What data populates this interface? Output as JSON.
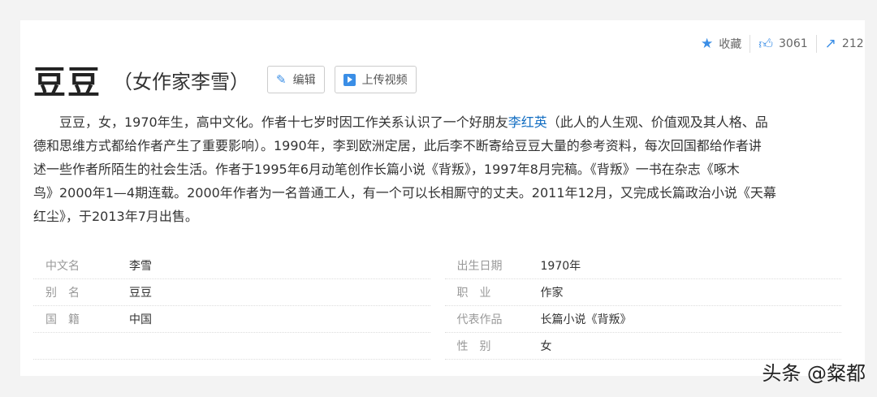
{
  "toolbar": {
    "favorite_label": "收藏",
    "like_count": "3061",
    "share_count": "212"
  },
  "header": {
    "title": "豆豆",
    "subtitle": "（女作家李雪）",
    "edit_label": "编辑",
    "upload_video_label": "上传视频"
  },
  "summary": {
    "lines": [
      [
        "　　豆豆，女，1970年生，高中文化。作者十七岁时因工作关系认识了一个好朋友",
        "李红英",
        "（此人的人生观、价值观及其人格、品"
      ],
      "德和思维方式都给作者产生了重要影响）。1990年，李到欧洲定居，此后李不断寄给豆豆大量的参考资料，每次回国都给作者讲",
      "述一些作者所陌生的社会生活。作者于1995年6月动笔创作长篇小说《背叛》，1997年8月完稿。《背叛》一书在杂志《啄木",
      "鸟》2000年1—4期连载。2000年作者为一名普通工人，有一个可以长相厮守的丈夫。2011年12月，又完成长篇政治小说《天幕",
      "红尘》，于2013年7月出售。"
    ]
  },
  "info": {
    "left": [
      {
        "k": "中文名",
        "v": "李雪"
      },
      {
        "k": "别　名",
        "v": "豆豆"
      },
      {
        "k": "国　籍",
        "v": "中国"
      },
      {
        "k": "",
        "v": ""
      }
    ],
    "right": [
      {
        "k": "出生日期",
        "v": "1970年"
      },
      {
        "k": "职　业",
        "v": "作家"
      },
      {
        "k": "代表作品",
        "v": "长篇小说《背叛》"
      },
      {
        "k": "性　别",
        "v": "女"
      }
    ]
  },
  "watermark": "头条 @粲都"
}
